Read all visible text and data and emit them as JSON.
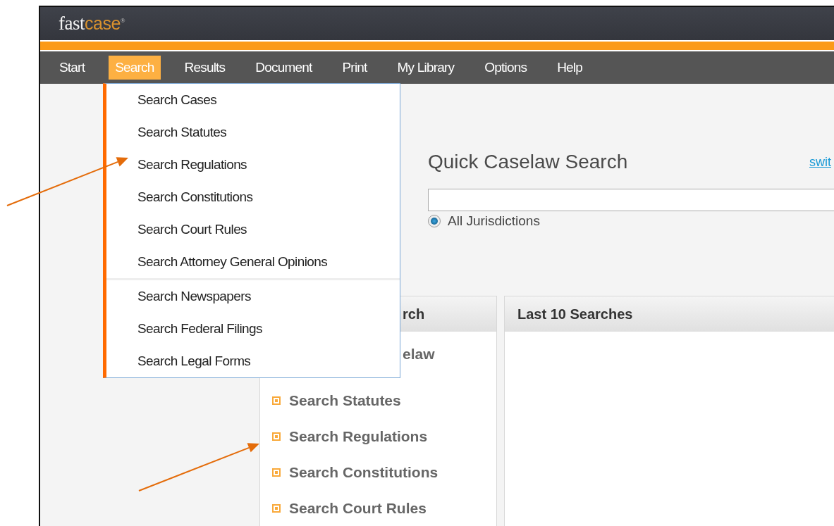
{
  "logo": {
    "text_main": "fast",
    "text_accent": "case",
    "mark": "®"
  },
  "nav": [
    {
      "label": "Start",
      "selected": false
    },
    {
      "label": "Search",
      "selected": true
    },
    {
      "label": "Results",
      "selected": false
    },
    {
      "label": "Document",
      "selected": false
    },
    {
      "label": "Print",
      "selected": false
    },
    {
      "label": "My Library",
      "selected": false
    },
    {
      "label": "Options",
      "selected": false
    },
    {
      "label": "Help",
      "selected": false
    }
  ],
  "search_menu": {
    "groups": [
      [
        "Search Cases",
        "Search Statutes",
        "Search Regulations",
        "Search Constitutions",
        "Search Court Rules",
        "Search Attorney General Opinions"
      ],
      [
        "Search Newspapers",
        "Search Federal Filings",
        "Search Legal Forms"
      ]
    ]
  },
  "quick_search": {
    "title": "Quick Caselaw Search",
    "link": "swit",
    "radio": {
      "label": "All Jurisdictions",
      "selected": true
    }
  },
  "quick_search_panel": {
    "title": "rch",
    "partial_item": "elaw",
    "items": [
      "Search Statutes",
      "Search Regulations",
      "Search Constitutions",
      "Search Court Rules"
    ]
  },
  "recent_panel": {
    "title": "Last 10 Searches"
  }
}
